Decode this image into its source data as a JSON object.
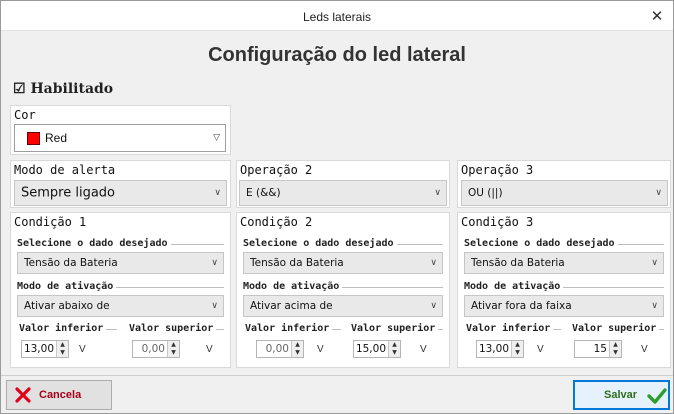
{
  "window": {
    "title": "Leds laterais",
    "close_icon": "close-icon"
  },
  "heading": "Configuração do led lateral",
  "enabled": {
    "label": "Habilitado",
    "checked": true
  },
  "color": {
    "label": "Cor",
    "value": "Red",
    "swatch": "#ff0000"
  },
  "alert_mode": {
    "label": "Modo de alerta",
    "value": "Sempre ligado"
  },
  "op2": {
    "label": "Operação 2",
    "value": "E (&&)"
  },
  "op3": {
    "label": "Operação 3",
    "value": "OU (||)"
  },
  "conditions": [
    {
      "title": "Condição 1",
      "data_label": "Selecione o dado desejado",
      "data_value": "Tensão da Bateria",
      "mode_label": "Modo de ativação",
      "mode_value": "Ativar abaixo de",
      "lower_label": "Valor inferior",
      "lower_value": "13,00",
      "upper_label": "Valor superior",
      "upper_value": "0,00",
      "unit": "V"
    },
    {
      "title": "Condição 2",
      "data_label": "Selecione o dado desejado",
      "data_value": "Tensão da Bateria",
      "mode_label": "Modo de ativação",
      "mode_value": "Ativar acima de",
      "lower_label": "Valor inferior",
      "lower_value": "0,00",
      "upper_label": "Valor superior",
      "upper_value": "15,00",
      "unit": "V"
    },
    {
      "title": "Condição 3",
      "data_label": "Selecione o dado desejado",
      "data_value": "Tensão da Bateria",
      "mode_label": "Modo de ativação",
      "mode_value": "Ativar fora da faixa",
      "lower_label": "Valor inferior",
      "lower_value": "13,00",
      "upper_label": "Valor superior",
      "upper_value": "15",
      "unit": "V"
    }
  ],
  "buttons": {
    "cancel": "Cancela",
    "save": "Salvar"
  },
  "colors": {
    "cancel_icon": "#e0001b",
    "save_icon": "#2e9e2e",
    "label_cancel": "#a8001a",
    "label_save": "#2d6d1c",
    "primary_border": "#0078d7"
  }
}
